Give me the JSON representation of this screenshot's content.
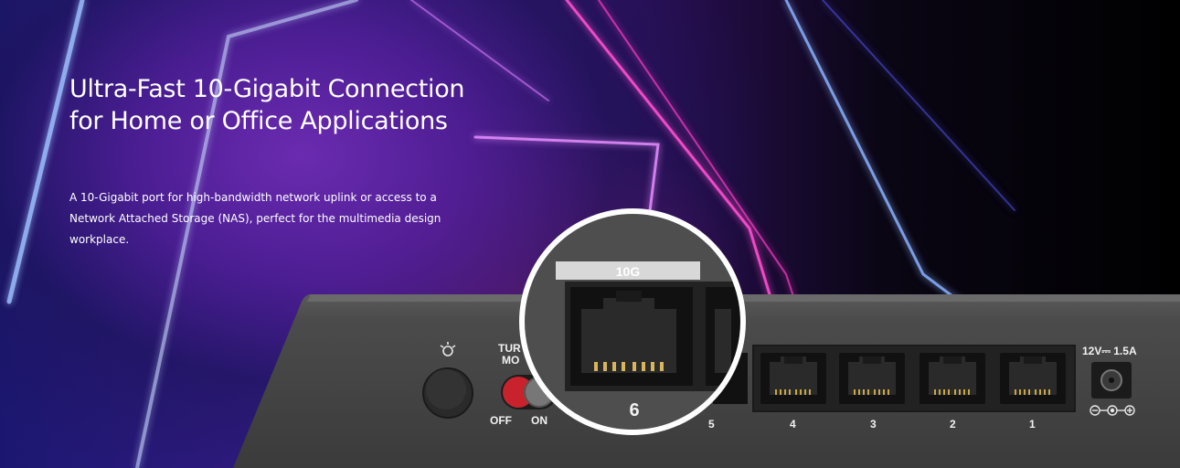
{
  "hero": {
    "headline_line1": "Ultra-Fast 10-Gigabit Connection",
    "headline_line2": "for Home or Office Applications",
    "desc_line1": "A 10-Gigabit port for high-bandwidth network uplink or access to a",
    "desc_line2": "Network Attached Storage (NAS), perfect for the multimedia design",
    "desc_line3": "workplace."
  },
  "device": {
    "turbo_label_line1": "TUR",
    "turbo_label_line2": "MO",
    "switch_off": "OFF",
    "switch_on": "ON",
    "power_rating": "12V⎓ 1.5A",
    "zoom_port_tag": "10G",
    "zoom_port_number": "6",
    "port_numbers": [
      "5",
      "4",
      "3",
      "2",
      "1"
    ]
  },
  "colors": {
    "device_body": "#4a4a4a",
    "turbo_switch": "#c8232c",
    "zoom_ring": "#ffffff",
    "port_tag": "#d8d8d8"
  },
  "icons": {
    "led_button": "led-light-icon",
    "power_polarity": "polarity-icon"
  }
}
